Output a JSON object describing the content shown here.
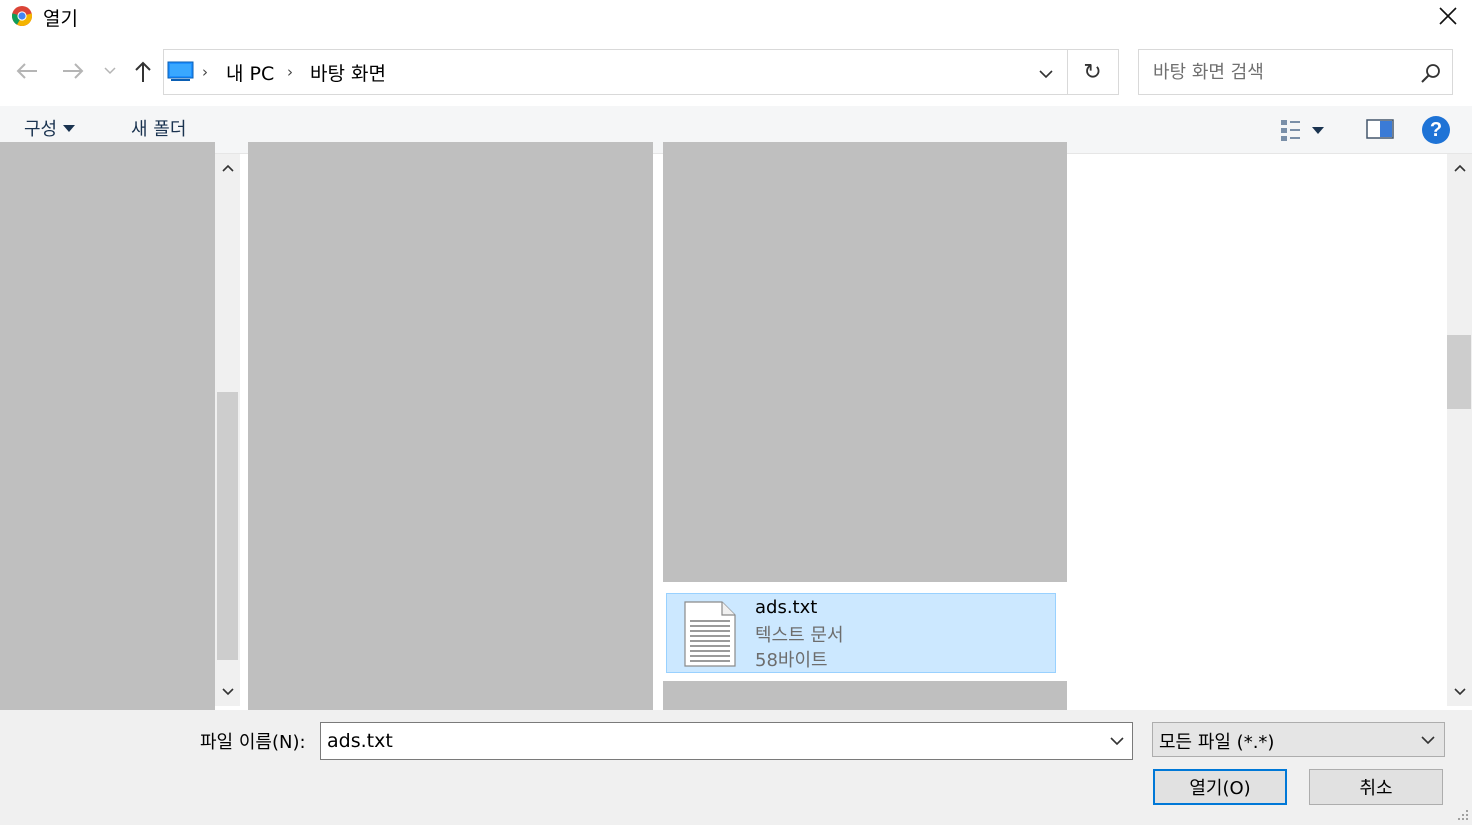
{
  "window": {
    "title": "열기"
  },
  "address": {
    "crumbs": [
      "내 PC",
      "바탕 화면"
    ],
    "search_placeholder": "바탕 화면 검색"
  },
  "toolbar": {
    "organize_label": "구성",
    "new_folder_label": "새 폴더",
    "help_label": "?"
  },
  "files": [
    {
      "name": "ads.txt",
      "type": "텍스트 문서",
      "size": "58바이트",
      "selected": true
    }
  ],
  "footer": {
    "filename_label": "파일 이름(N):",
    "filename_value": "ads.txt",
    "filetype_value": "모든 파일 (*.*)",
    "open_label": "열기(O)",
    "cancel_label": "취소"
  },
  "colors": {
    "selection": "#cce8ff",
    "selection_border": "#99d1ff",
    "accent": "#0078d7",
    "redaction": "#bfbfbf"
  }
}
